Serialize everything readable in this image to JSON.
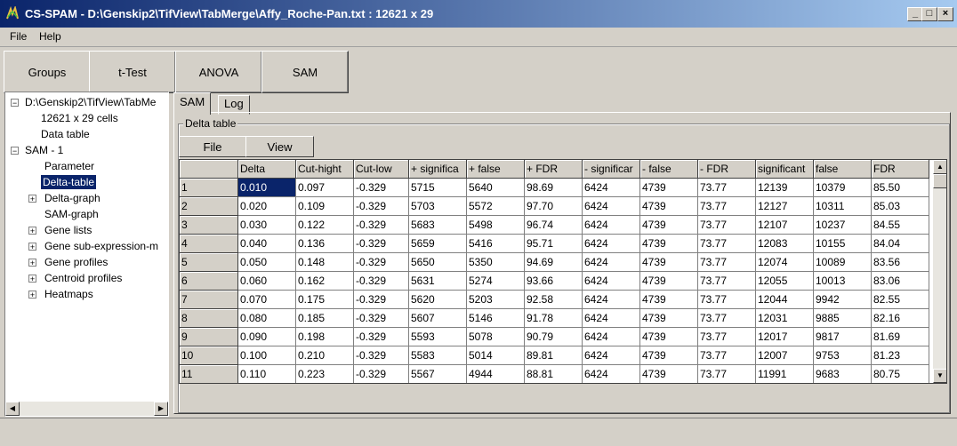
{
  "window": {
    "title": "CS-SPAM - D:\\Genskip2\\TifView\\TabMerge\\Affy_Roche-Pan.txt :  12621 x 29"
  },
  "menu": [
    {
      "label": "File"
    },
    {
      "label": "Help"
    }
  ],
  "toolbar": [
    {
      "label": "Groups"
    },
    {
      "label": "t-Test"
    },
    {
      "label": "ANOVA"
    },
    {
      "label": "SAM"
    }
  ],
  "tree": [
    {
      "label": "D:\\Genskip2\\TifView\\TabMe",
      "level": 0,
      "expander": "-"
    },
    {
      "label": "12621 x 29 cells",
      "level": 1,
      "expander": ""
    },
    {
      "label": "Data table",
      "level": 1,
      "expander": ""
    },
    {
      "label": "SAM - 1",
      "level": 0,
      "expander": "-"
    },
    {
      "label": "Parameter",
      "level": 1,
      "expander": ""
    },
    {
      "label": "Delta-table",
      "level": 1,
      "expander": "",
      "selected": true
    },
    {
      "label": "Delta-graph",
      "level": 1,
      "expander": "+"
    },
    {
      "label": "SAM-graph",
      "level": 1,
      "expander": ""
    },
    {
      "label": "Gene lists",
      "level": 1,
      "expander": "+"
    },
    {
      "label": "Gene sub-expression-m",
      "level": 1,
      "expander": "+"
    },
    {
      "label": "Gene profiles",
      "level": 1,
      "expander": "+"
    },
    {
      "label": "Centroid profiles",
      "level": 1,
      "expander": "+"
    },
    {
      "label": "Heatmaps",
      "level": 1,
      "expander": "+"
    }
  ],
  "tabs": [
    {
      "label": "SAM",
      "active": true
    },
    {
      "label": "Log",
      "active": false
    }
  ],
  "delta_table": {
    "group_label": "Delta table",
    "buttons": [
      {
        "label": "File"
      },
      {
        "label": "View"
      }
    ],
    "columns": [
      "",
      "Delta",
      "Cut-hight",
      "Cut-low",
      "+ significa",
      "+ false",
      "+ FDR",
      "- significar",
      "- false",
      "- FDR",
      "significant",
      "false",
      "FDR"
    ],
    "rows": [
      [
        "1",
        "0.010",
        "0.097",
        "-0.329",
        "5715",
        "5640",
        "98.69",
        "6424",
        "4739",
        "73.77",
        "12139",
        "10379",
        "85.50"
      ],
      [
        "2",
        "0.020",
        "0.109",
        "-0.329",
        "5703",
        "5572",
        "97.70",
        "6424",
        "4739",
        "73.77",
        "12127",
        "10311",
        "85.03"
      ],
      [
        "3",
        "0.030",
        "0.122",
        "-0.329",
        "5683",
        "5498",
        "96.74",
        "6424",
        "4739",
        "73.77",
        "12107",
        "10237",
        "84.55"
      ],
      [
        "4",
        "0.040",
        "0.136",
        "-0.329",
        "5659",
        "5416",
        "95.71",
        "6424",
        "4739",
        "73.77",
        "12083",
        "10155",
        "84.04"
      ],
      [
        "5",
        "0.050",
        "0.148",
        "-0.329",
        "5650",
        "5350",
        "94.69",
        "6424",
        "4739",
        "73.77",
        "12074",
        "10089",
        "83.56"
      ],
      [
        "6",
        "0.060",
        "0.162",
        "-0.329",
        "5631",
        "5274",
        "93.66",
        "6424",
        "4739",
        "73.77",
        "12055",
        "10013",
        "83.06"
      ],
      [
        "7",
        "0.070",
        "0.175",
        "-0.329",
        "5620",
        "5203",
        "92.58",
        "6424",
        "4739",
        "73.77",
        "12044",
        "9942",
        "82.55"
      ],
      [
        "8",
        "0.080",
        "0.185",
        "-0.329",
        "5607",
        "5146",
        "91.78",
        "6424",
        "4739",
        "73.77",
        "12031",
        "9885",
        "82.16"
      ],
      [
        "9",
        "0.090",
        "0.198",
        "-0.329",
        "5593",
        "5078",
        "90.79",
        "6424",
        "4739",
        "73.77",
        "12017",
        "9817",
        "81.69"
      ],
      [
        "10",
        "0.100",
        "0.210",
        "-0.329",
        "5583",
        "5014",
        "89.81",
        "6424",
        "4739",
        "73.77",
        "12007",
        "9753",
        "81.23"
      ],
      [
        "11",
        "0.110",
        "0.223",
        "-0.329",
        "5567",
        "4944",
        "88.81",
        "6424",
        "4739",
        "73.77",
        "11991",
        "9683",
        "80.75"
      ]
    ],
    "selected_cell": {
      "row": 0,
      "col": 1
    }
  },
  "colors": {
    "title_start": "#0a246a",
    "title_end": "#a6caf0",
    "selection": "#0a246a",
    "face": "#d4d0c8"
  }
}
